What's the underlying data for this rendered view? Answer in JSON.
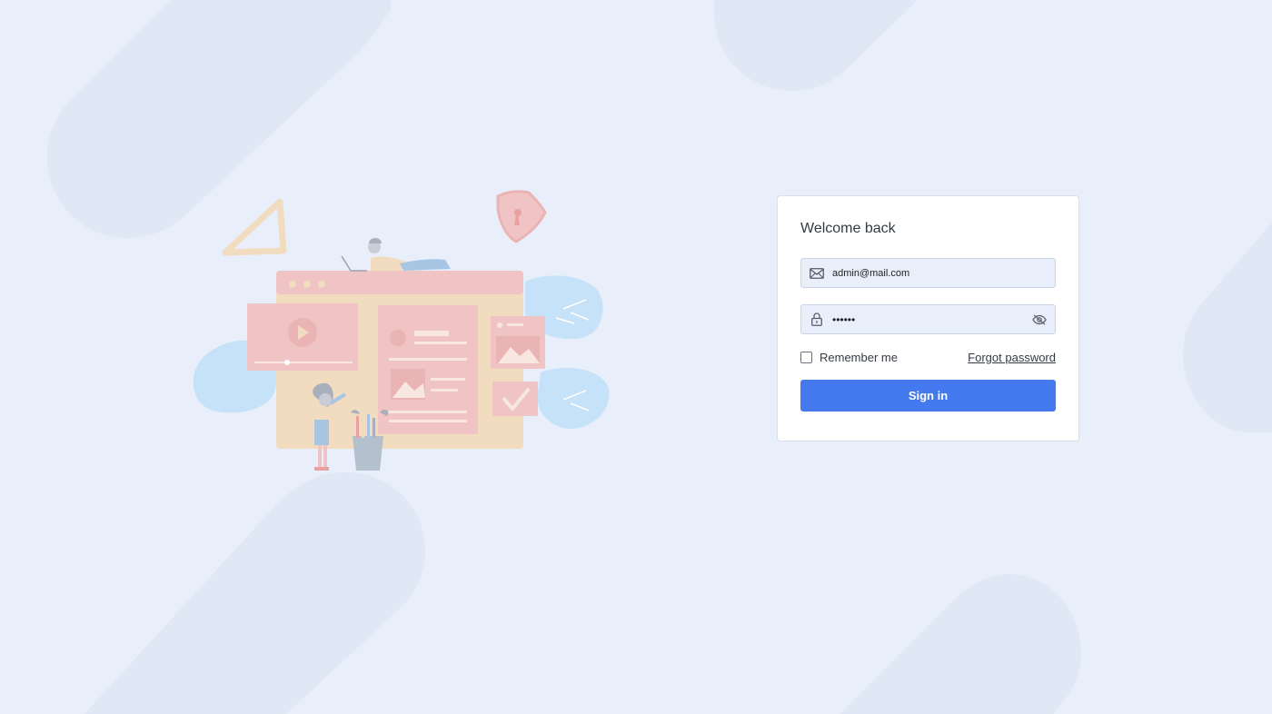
{
  "login": {
    "title": "Welcome back",
    "email": {
      "value": "admin@mail.com",
      "icon": "mail-icon"
    },
    "password": {
      "value": "••••••",
      "icon": "lock-icon",
      "toggle_icon": "eye-off-icon"
    },
    "remember_label": "Remember me",
    "remember_checked": false,
    "forgot_label": "Forgot password",
    "signin_label": "Sign in"
  },
  "colors": {
    "background": "#e8effb",
    "accent": "#4479ef",
    "card": "#ffffff"
  }
}
